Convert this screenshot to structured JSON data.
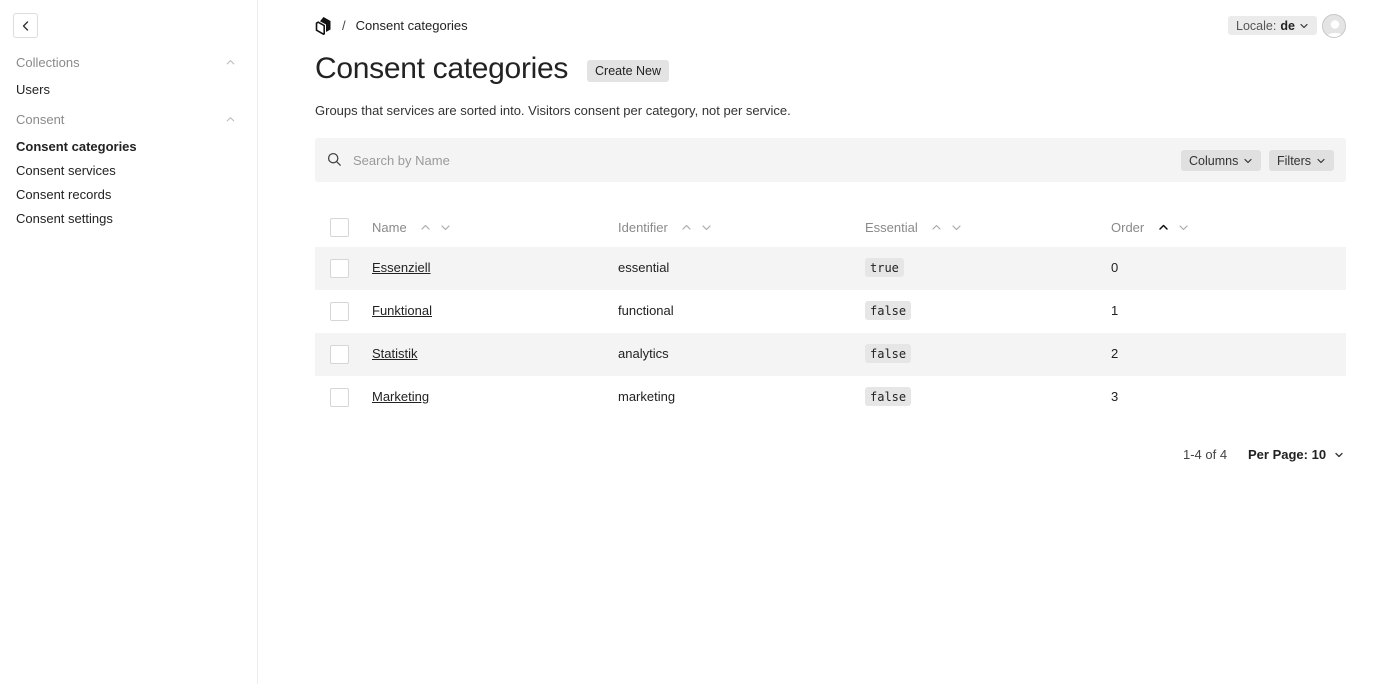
{
  "sidebar": {
    "back_icon": "chevron-left-icon",
    "groups": [
      {
        "label": "Collections",
        "items": [
          "Users"
        ]
      },
      {
        "label": "Consent",
        "items": [
          "Consent categories",
          "Consent services",
          "Consent records",
          "Consent settings"
        ]
      }
    ],
    "active_item": "Consent categories"
  },
  "header": {
    "logo_icon": "payload-logo-icon",
    "breadcrumb_separator": "/",
    "breadcrumb_current": "Consent categories",
    "locale_label": "Locale:",
    "locale_value": "de"
  },
  "page": {
    "title": "Consent categories",
    "create_label": "Create New",
    "description": "Groups that services are sorted into. Visitors consent per category, not per service."
  },
  "search": {
    "placeholder": "Search by Name",
    "columns_label": "Columns",
    "filters_label": "Filters"
  },
  "table": {
    "columns": [
      "Name",
      "Identifier",
      "Essential",
      "Order"
    ],
    "active_sort": "Order ascending",
    "rows": [
      {
        "name": "Essenziell",
        "identifier": "essential",
        "essential": "true",
        "order": "0"
      },
      {
        "name": "Funktional",
        "identifier": "functional",
        "essential": "false",
        "order": "1"
      },
      {
        "name": "Statistik",
        "identifier": "analytics",
        "essential": "false",
        "order": "2"
      },
      {
        "name": "Marketing",
        "identifier": "marketing",
        "essential": "false",
        "order": "3"
      }
    ]
  },
  "pagination": {
    "range": "1-4 of 4",
    "per_page": "Per Page: 10"
  },
  "colors": {
    "row_shade": "#f4f4f4",
    "muted_text": "#8a8a8a",
    "button_bg": "#e3e3e3"
  }
}
